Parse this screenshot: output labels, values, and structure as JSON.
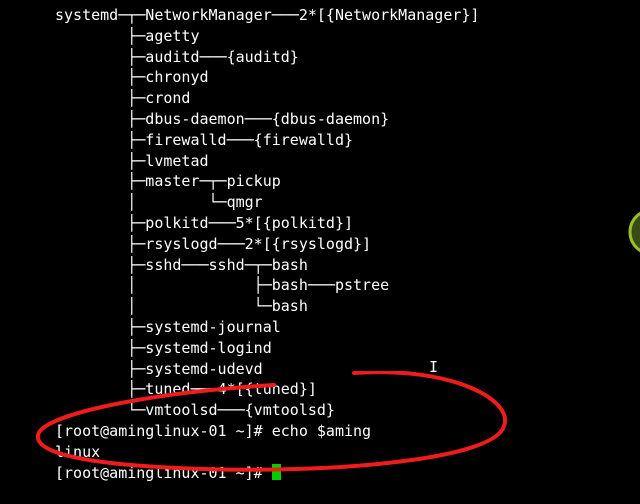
{
  "tree": {
    "l01": "systemd─┬─NetworkManager───2*[{NetworkManager}]",
    "l02": "        ├─agetty",
    "l03": "        ├─auditd───{auditd}",
    "l04": "        ├─chronyd",
    "l05": "        ├─crond",
    "l06": "        ├─dbus-daemon───{dbus-daemon}",
    "l07": "        ├─firewalld───{firewalld}",
    "l08": "        ├─lvmetad",
    "l09": "        ├─master─┬─pickup",
    "l10": "        │        └─qmgr",
    "l11": "        ├─polkitd───5*[{polkitd}]",
    "l12": "        ├─rsyslogd───2*[{rsyslogd}]",
    "l13": "        ├─sshd───sshd─┬─bash",
    "l14": "        │             ├─bash───pstree",
    "l15": "        │             └─bash",
    "l16": "        ├─systemd-journal",
    "l17": "        ├─systemd-logind",
    "l18": "        ├─systemd-udevd",
    "l19": "        ├─tuned───4*[{tuned}]",
    "l20": "        └─vmtoolsd───{vmtoolsd}"
  },
  "prompt1": "[root@aminglinux-01 ~]# ",
  "cmd1": "echo $aming",
  "output1": "linux",
  "prompt2": "[root@aminglinux-01 ~]# ",
  "annotation_color": "#f01b1b"
}
